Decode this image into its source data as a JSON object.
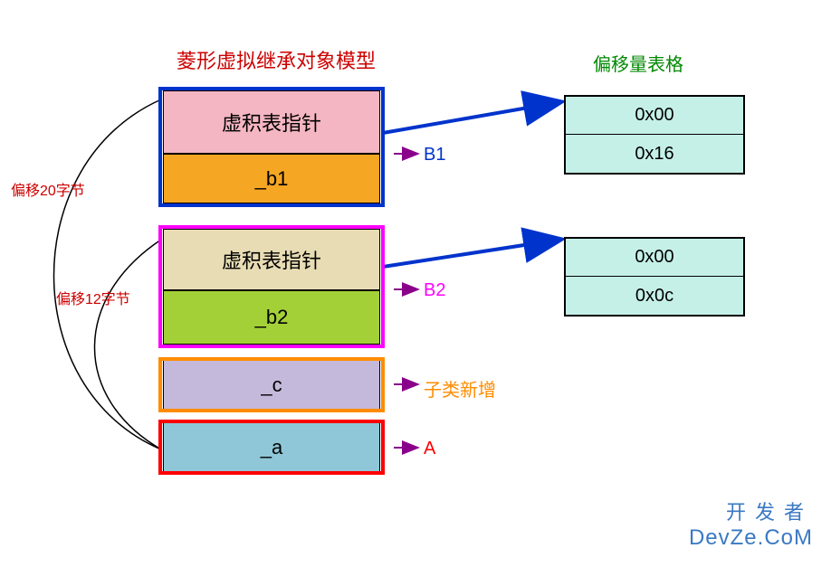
{
  "titles": {
    "main": "菱形虚拟继承对象模型",
    "offset_table": "偏移量表格"
  },
  "offset_labels": {
    "twenty": "偏移20字节",
    "twelve": "偏移12字节"
  },
  "blocks": {
    "vptr1": "虚积表指针",
    "b1": "_b1",
    "vptr2": "虚积表指针",
    "b2": "_b2",
    "c": "_c",
    "a": "_a"
  },
  "side_labels": {
    "b1": "B1",
    "b2": "B2",
    "c": "子类新增",
    "a": "A"
  },
  "offset_tables": {
    "t1": {
      "row1": "0x00",
      "row2": "0x16"
    },
    "t2": {
      "row1": "0x00",
      "row2": "0x0c"
    }
  },
  "watermark": {
    "cn": "开发者",
    "en": "DevZe.CoM"
  }
}
